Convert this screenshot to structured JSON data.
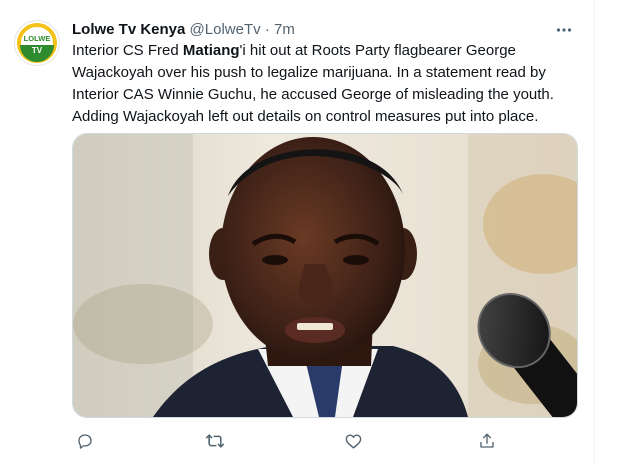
{
  "tweet": {
    "display_name": "Lolwe Tv Kenya",
    "handle": "@LolweTv",
    "separator": "·",
    "time": "7m",
    "text_before": "Interior CS Fred ",
    "text_highlight": "Matiang",
    "text_after": "'i hit out at Roots Party flagbearer George Wajackoyah over his push to legalize marijuana. In a statement read by Interior CAS Winnie Guchu, he accused George of misleading the youth. Adding Wajackoyah left out details on control measures put into place.",
    "avatar": {
      "logo_line1": "LOLWE",
      "logo_line2": "TV",
      "ring_color": "#f2c21a",
      "band_color": "#2e8b2e"
    },
    "media": {
      "kind": "photo",
      "alt": ""
    },
    "actions": [
      {
        "name": "reply",
        "icon": "reply-icon"
      },
      {
        "name": "retweet",
        "icon": "retweet-icon"
      },
      {
        "name": "like",
        "icon": "heart-icon"
      },
      {
        "name": "share",
        "icon": "share-icon"
      }
    ],
    "more_icon": "more-options-icon"
  },
  "colors": {
    "text_primary": "#0f1419",
    "text_secondary": "#536471",
    "border": "#cfd9de"
  }
}
